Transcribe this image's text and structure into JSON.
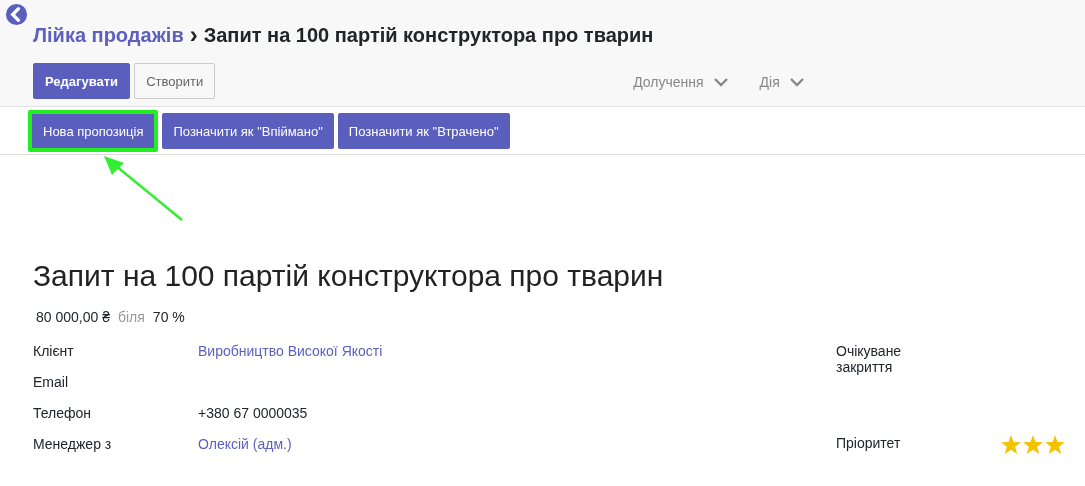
{
  "breadcrumb": {
    "parent": "Лійка продажів",
    "separator": "›",
    "current": "Запит на 100 партій конструктора про тварин"
  },
  "main_buttons": [
    {
      "label": "Редагувати",
      "kind": "primary"
    },
    {
      "label": "Створити",
      "kind": "secondary"
    }
  ],
  "dropdowns": [
    {
      "label": "Долучення"
    },
    {
      "label": "Дія"
    }
  ],
  "status_buttons": [
    {
      "label": "Нова пропозиція",
      "highlighted": true
    },
    {
      "label": "Позначити як \"Впіймано\"",
      "highlighted": false
    },
    {
      "label": "Позначити як \"Втрачено\"",
      "highlighted": false
    }
  ],
  "form": {
    "title": "Запит на 100 партій конструктора про тварин",
    "revenue": "80 000,00 ₴",
    "near": "біля",
    "probability": "70 %",
    "left_fields": [
      {
        "label": "Клієнт",
        "value": "Виробництво Високої Якості",
        "kind": "link"
      },
      {
        "label": "Email"
      },
      {
        "label": "Телефон",
        "value": "+380 67 0000035",
        "kind": "text"
      },
      {
        "label": "Менеджер з",
        "value": "Олексій (адм.)",
        "kind": "link"
      }
    ],
    "right_fields": [
      {
        "label": "Очікуване закриття",
        "kind": "text"
      },
      {
        "label": "Пріоритет",
        "kind": "stars",
        "stars": 3
      }
    ]
  }
}
